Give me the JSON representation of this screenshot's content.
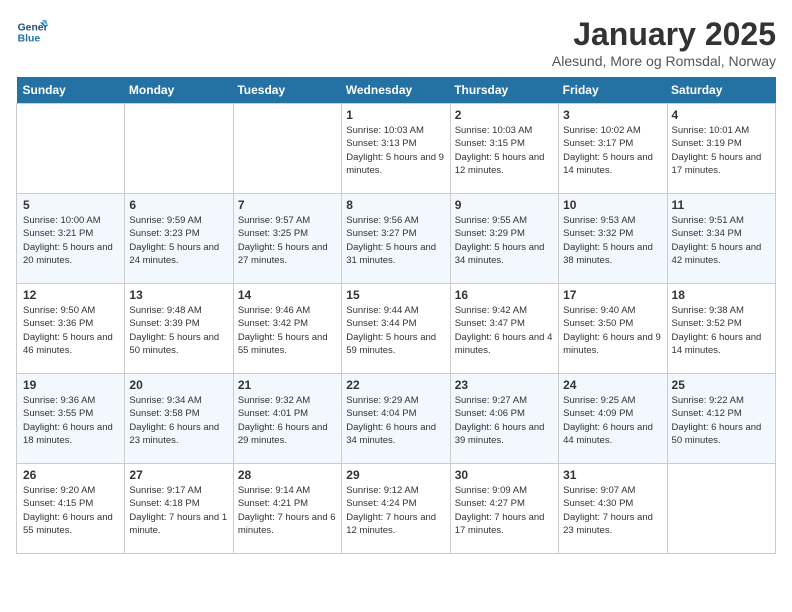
{
  "header": {
    "logo_line1": "General",
    "logo_line2": "Blue",
    "title": "January 2025",
    "subtitle": "Alesund, More og Romsdal, Norway"
  },
  "days_of_week": [
    "Sunday",
    "Monday",
    "Tuesday",
    "Wednesday",
    "Thursday",
    "Friday",
    "Saturday"
  ],
  "weeks": [
    {
      "days": [
        {
          "num": "",
          "info": ""
        },
        {
          "num": "",
          "info": ""
        },
        {
          "num": "",
          "info": ""
        },
        {
          "num": "1",
          "info": "Sunrise: 10:03 AM\nSunset: 3:13 PM\nDaylight: 5 hours and 9 minutes."
        },
        {
          "num": "2",
          "info": "Sunrise: 10:03 AM\nSunset: 3:15 PM\nDaylight: 5 hours and 12 minutes."
        },
        {
          "num": "3",
          "info": "Sunrise: 10:02 AM\nSunset: 3:17 PM\nDaylight: 5 hours and 14 minutes."
        },
        {
          "num": "4",
          "info": "Sunrise: 10:01 AM\nSunset: 3:19 PM\nDaylight: 5 hours and 17 minutes."
        }
      ]
    },
    {
      "days": [
        {
          "num": "5",
          "info": "Sunrise: 10:00 AM\nSunset: 3:21 PM\nDaylight: 5 hours and 20 minutes."
        },
        {
          "num": "6",
          "info": "Sunrise: 9:59 AM\nSunset: 3:23 PM\nDaylight: 5 hours and 24 minutes."
        },
        {
          "num": "7",
          "info": "Sunrise: 9:57 AM\nSunset: 3:25 PM\nDaylight: 5 hours and 27 minutes."
        },
        {
          "num": "8",
          "info": "Sunrise: 9:56 AM\nSunset: 3:27 PM\nDaylight: 5 hours and 31 minutes."
        },
        {
          "num": "9",
          "info": "Sunrise: 9:55 AM\nSunset: 3:29 PM\nDaylight: 5 hours and 34 minutes."
        },
        {
          "num": "10",
          "info": "Sunrise: 9:53 AM\nSunset: 3:32 PM\nDaylight: 5 hours and 38 minutes."
        },
        {
          "num": "11",
          "info": "Sunrise: 9:51 AM\nSunset: 3:34 PM\nDaylight: 5 hours and 42 minutes."
        }
      ]
    },
    {
      "days": [
        {
          "num": "12",
          "info": "Sunrise: 9:50 AM\nSunset: 3:36 PM\nDaylight: 5 hours and 46 minutes."
        },
        {
          "num": "13",
          "info": "Sunrise: 9:48 AM\nSunset: 3:39 PM\nDaylight: 5 hours and 50 minutes."
        },
        {
          "num": "14",
          "info": "Sunrise: 9:46 AM\nSunset: 3:42 PM\nDaylight: 5 hours and 55 minutes."
        },
        {
          "num": "15",
          "info": "Sunrise: 9:44 AM\nSunset: 3:44 PM\nDaylight: 5 hours and 59 minutes."
        },
        {
          "num": "16",
          "info": "Sunrise: 9:42 AM\nSunset: 3:47 PM\nDaylight: 6 hours and 4 minutes."
        },
        {
          "num": "17",
          "info": "Sunrise: 9:40 AM\nSunset: 3:50 PM\nDaylight: 6 hours and 9 minutes."
        },
        {
          "num": "18",
          "info": "Sunrise: 9:38 AM\nSunset: 3:52 PM\nDaylight: 6 hours and 14 minutes."
        }
      ]
    },
    {
      "days": [
        {
          "num": "19",
          "info": "Sunrise: 9:36 AM\nSunset: 3:55 PM\nDaylight: 6 hours and 18 minutes."
        },
        {
          "num": "20",
          "info": "Sunrise: 9:34 AM\nSunset: 3:58 PM\nDaylight: 6 hours and 23 minutes."
        },
        {
          "num": "21",
          "info": "Sunrise: 9:32 AM\nSunset: 4:01 PM\nDaylight: 6 hours and 29 minutes."
        },
        {
          "num": "22",
          "info": "Sunrise: 9:29 AM\nSunset: 4:04 PM\nDaylight: 6 hours and 34 minutes."
        },
        {
          "num": "23",
          "info": "Sunrise: 9:27 AM\nSunset: 4:06 PM\nDaylight: 6 hours and 39 minutes."
        },
        {
          "num": "24",
          "info": "Sunrise: 9:25 AM\nSunset: 4:09 PM\nDaylight: 6 hours and 44 minutes."
        },
        {
          "num": "25",
          "info": "Sunrise: 9:22 AM\nSunset: 4:12 PM\nDaylight: 6 hours and 50 minutes."
        }
      ]
    },
    {
      "days": [
        {
          "num": "26",
          "info": "Sunrise: 9:20 AM\nSunset: 4:15 PM\nDaylight: 6 hours and 55 minutes."
        },
        {
          "num": "27",
          "info": "Sunrise: 9:17 AM\nSunset: 4:18 PM\nDaylight: 7 hours and 1 minute."
        },
        {
          "num": "28",
          "info": "Sunrise: 9:14 AM\nSunset: 4:21 PM\nDaylight: 7 hours and 6 minutes."
        },
        {
          "num": "29",
          "info": "Sunrise: 9:12 AM\nSunset: 4:24 PM\nDaylight: 7 hours and 12 minutes."
        },
        {
          "num": "30",
          "info": "Sunrise: 9:09 AM\nSunset: 4:27 PM\nDaylight: 7 hours and 17 minutes."
        },
        {
          "num": "31",
          "info": "Sunrise: 9:07 AM\nSunset: 4:30 PM\nDaylight: 7 hours and 23 minutes."
        },
        {
          "num": "",
          "info": ""
        }
      ]
    }
  ]
}
